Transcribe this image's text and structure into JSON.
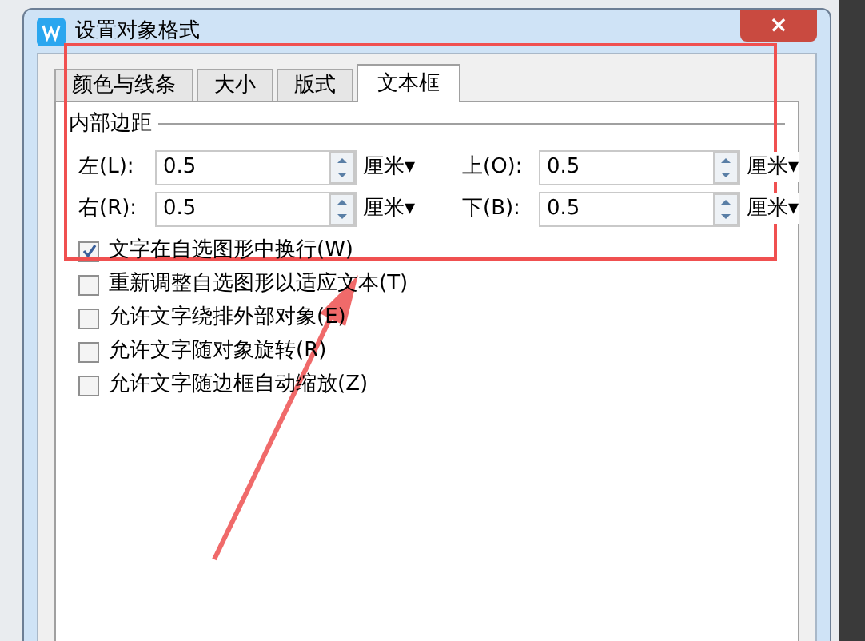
{
  "window": {
    "title": "设置对象格式",
    "close": "×"
  },
  "tabs": [
    {
      "label": "颜色与线条",
      "selected": false
    },
    {
      "label": "大小",
      "selected": false
    },
    {
      "label": "版式",
      "selected": false
    },
    {
      "label": "文本框",
      "selected": true
    }
  ],
  "group": {
    "title": "内部边距"
  },
  "margins": [
    {
      "label": "左(L):",
      "value": "0.5",
      "unit": "厘米▾"
    },
    {
      "label": "上(O):",
      "value": "0.5",
      "unit": "厘米▾"
    },
    {
      "label": "右(R):",
      "value": "0.5",
      "unit": "厘米▾"
    },
    {
      "label": "下(B):",
      "value": "0.5",
      "unit": "厘米▾"
    }
  ],
  "options": [
    {
      "label": "文字在自选图形中换行(W)",
      "checked": true
    },
    {
      "label": "重新调整自选图形以适应文本(T)",
      "checked": false
    },
    {
      "label": "允许文字绕排外部对象(E)",
      "checked": false
    },
    {
      "label": "允许文字随对象旋转(R)",
      "checked": false
    },
    {
      "label": "允许文字随边框自动缩放(Z)",
      "checked": false
    }
  ]
}
